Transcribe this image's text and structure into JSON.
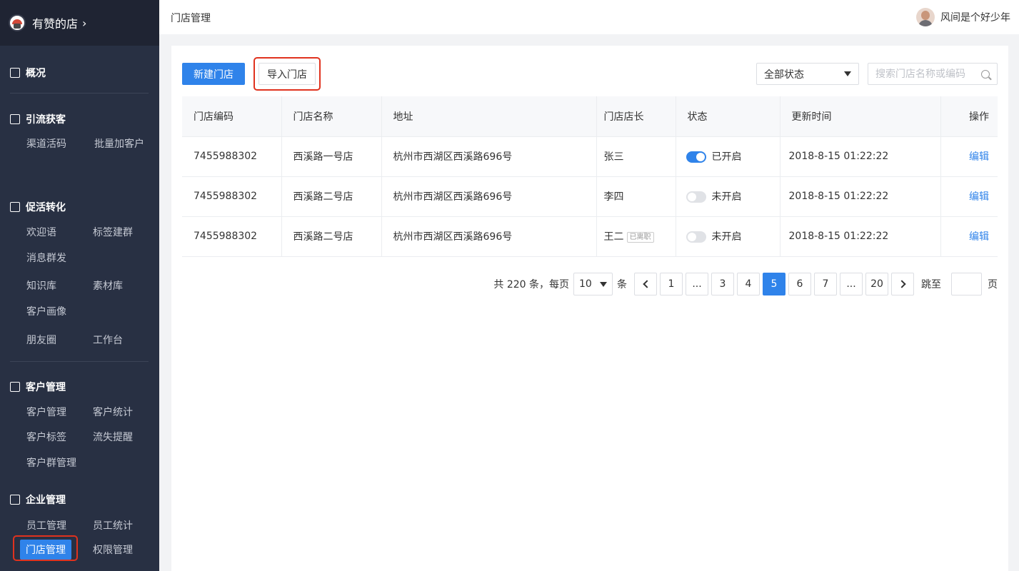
{
  "sidebar": {
    "shop_name": "有赞的店",
    "chevron": "›",
    "sections": [
      {
        "title": "概况",
        "icon": "dashboard-icon",
        "items": []
      },
      {
        "title": "引流获客",
        "icon": "store-icon",
        "items": [
          "渠道活码",
          "批量加客户"
        ]
      },
      {
        "title": "促活转化",
        "icon": "calendar-check-icon",
        "items": [
          "欢迎语",
          "标签建群",
          "消息群发",
          "知识库",
          "素材库",
          "客户画像",
          "朋友圈",
          "工作台"
        ]
      },
      {
        "title": "客户管理",
        "icon": "user-icon",
        "items": [
          "客户管理",
          "客户统计",
          "客户标签",
          "流失提醒",
          "客户群管理"
        ]
      },
      {
        "title": "企业管理",
        "icon": "building-icon",
        "items": [
          "员工管理",
          "员工统计",
          "门店管理",
          "权限管理"
        ]
      }
    ],
    "active_item": "门店管理"
  },
  "topbar": {
    "page_title": "门店管理",
    "user_name": "风间是个好少年"
  },
  "toolbar": {
    "new_store_label": "新建门店",
    "import_store_label": "导入门店",
    "status_filter": "全部状态",
    "search_placeholder": "搜索门店名称或编码"
  },
  "table": {
    "columns": [
      "门店编码",
      "门店名称",
      "地址",
      "门店店长",
      "状态",
      "更新时间",
      "操作"
    ],
    "rows": [
      {
        "code": "7455988302",
        "name": "西溪路一号店",
        "address": "杭州市西湖区西溪路696号",
        "manager": "张三",
        "manager_tag": "",
        "status_on": true,
        "status": "已开启",
        "updated": "2018-8-15 01:22:22",
        "action": "编辑"
      },
      {
        "code": "7455988302",
        "name": "西溪路二号店",
        "address": "杭州市西湖区西溪路696号",
        "manager": "李四",
        "manager_tag": "",
        "status_on": false,
        "status": "未开启",
        "updated": "2018-8-15 01:22:22",
        "action": "编辑"
      },
      {
        "code": "7455988302",
        "name": "西溪路二号店",
        "address": "杭州市西湖区西溪路696号",
        "manager": "王二",
        "manager_tag": "已离职",
        "status_on": false,
        "status": "未开启",
        "updated": "2018-8-15 01:22:22",
        "action": "编辑"
      }
    ]
  },
  "pagination": {
    "total_text": "共 220 条，每页",
    "page_size": "10",
    "unit": "条",
    "pages": [
      "1",
      "...",
      "3",
      "4",
      "5",
      "6",
      "7",
      "...",
      "20"
    ],
    "current_page": "5",
    "jump_label": "跳至",
    "page_label": "页"
  },
  "colors": {
    "accent": "#2f83ea",
    "sidebar_bg": "#283043",
    "highlight": "#e0321e"
  }
}
